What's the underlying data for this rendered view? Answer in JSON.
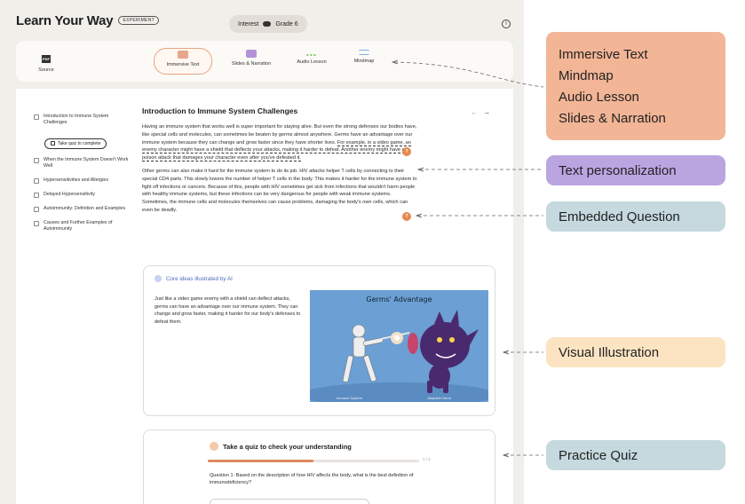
{
  "app": {
    "title": "Learn Your Way",
    "badge": "EXPERIMENT",
    "interest_label": "Interest",
    "grade_label": "Grade 6",
    "info_glyph": "i"
  },
  "modes": {
    "source_label": "Source",
    "source_icon_text": "PDF",
    "items": [
      {
        "label": "Immersive Text",
        "icon": "immersive-text-icon",
        "active": true
      },
      {
        "label": "Slides & Narration",
        "icon": "slides-icon",
        "active": false
      },
      {
        "label": "Audio Lesson",
        "icon": "audio-wave-icon",
        "active": false
      },
      {
        "label": "Mindmap",
        "icon": "mindmap-icon",
        "active": false
      }
    ]
  },
  "toc": {
    "items": [
      {
        "label": "Introduction to Immune System Challenges"
      },
      {
        "label": "When the Immune System Doesn't Work Well"
      },
      {
        "label": "Hypersensitivities and Allergies"
      },
      {
        "label": "Delayed Hypersensitivity"
      },
      {
        "label": "Autoimmunity: Definition and Examples"
      },
      {
        "label": "Causes and Further Examples of Autoimmunity"
      }
    ],
    "quiz_button": "Take quiz to complete"
  },
  "article": {
    "title": "Introduction to Immune System Challenges",
    "nav_prev": "←",
    "nav_next": "→",
    "para1_a": "Having an immune system that works well is super important for staying alive. But even the strong defenses our bodies have, like special cells and molecules, can sometimes be beaten by germs almost anywhere. Germs have an advantage over our immune system because they can change and grow faster since they have shorter lives. ",
    "para1_personal": "For example, in a video game, an enemy character might have a shield that deflects your attacks, making it harder to defeat. Another enemy might have a poison attack that damages your character even after you've defeated it.",
    "para2": "Other germs can also make it hard for the immune system to do its job. HIV attacks helper T cells by connecting to their special CD4 parts. This slowly lowers the number of helper T cells in the body. This makes it harder for the immune system to fight off infections or cancers. Because of this, people with HIV sometimes get sick from infections that wouldn't harm people with healthy immune systems, but these infections can be very dangerous for people with weak immune systems. Sometimes, the immune cells and molecules themselves can cause problems, damaging the body's own cells, which can even be deadly.",
    "question_marker": "?"
  },
  "illustration": {
    "heading": "Core ideas illustrated by AI",
    "body": "Just like a video game enemy with a shield can deflect attacks, germs can have an advantage over our immune system. They can change and grow faster, making it harder for our body's defenses to defeat them.",
    "image_title": "Germs' Advantage",
    "caption_left": "Immune System",
    "caption_right": "Adaptive Germ"
  },
  "quiz": {
    "heading": "Take a quiz to check your understanding",
    "progress": 0.5,
    "progress_text": "1 / 2",
    "question": "Question 1: Based on the description of how HIV affects the body, what is the best definition of immunodeficiency?"
  },
  "callouts": {
    "modes": [
      "Immersive Text",
      "Mindmap",
      "Audio Lesson",
      "Slides & Narration"
    ],
    "personalization": "Text personalization",
    "embedded": "Embedded Question",
    "visual": "Visual Illustration",
    "quiz": "Practice Quiz"
  },
  "colors": {
    "accent_orange": "#e48a4e",
    "callout_modes": "#f2b596",
    "callout_personal": "#bba5e1",
    "callout_embedded": "#c5d9df",
    "callout_visual": "#fce4c2",
    "illustration_bg": "#6c9fd3"
  }
}
